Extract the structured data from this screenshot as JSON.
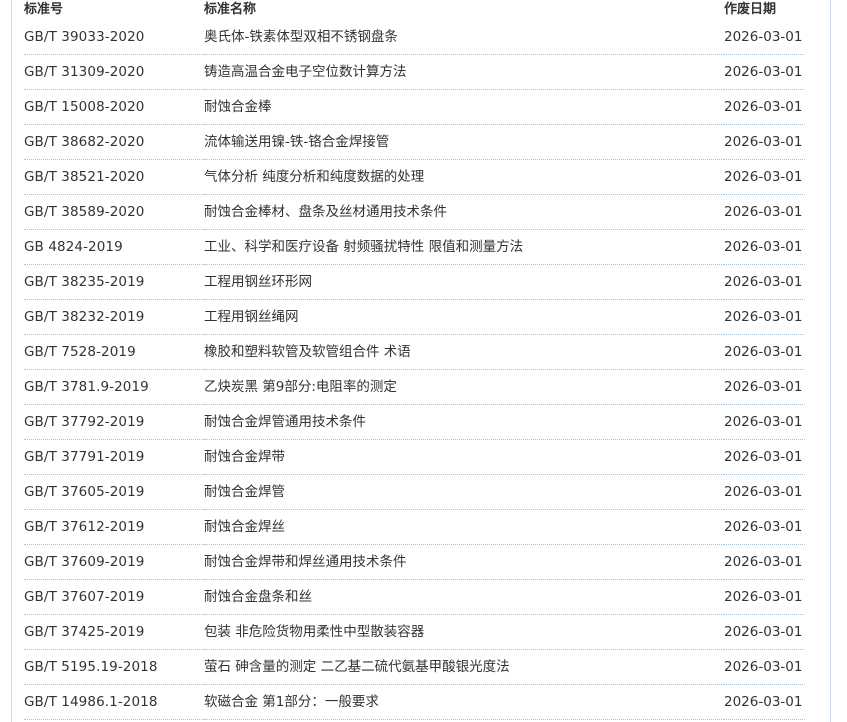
{
  "table": {
    "headers": {
      "code": "标准号",
      "name": "标准名称",
      "date": "作废日期"
    },
    "rows": [
      {
        "code": "GB/T 39033-2020",
        "name": "奥氏体-铁素体型双相不锈钢盘条",
        "date": "2026-03-01"
      },
      {
        "code": "GB/T 31309-2020",
        "name": "铸造高温合金电子空位数计算方法",
        "date": "2026-03-01"
      },
      {
        "code": "GB/T 15008-2020",
        "name": "耐蚀合金棒",
        "date": "2026-03-01"
      },
      {
        "code": "GB/T 38682-2020",
        "name": "流体输送用镍-铁-铬合金焊接管",
        "date": "2026-03-01"
      },
      {
        "code": "GB/T 38521-2020",
        "name": "气体分析 纯度分析和纯度数据的处理",
        "date": "2026-03-01"
      },
      {
        "code": "GB/T 38589-2020",
        "name": "耐蚀合金棒材、盘条及丝材通用技术条件",
        "date": "2026-03-01"
      },
      {
        "code": "GB 4824-2019",
        "name": "工业、科学和医疗设备 射频骚扰特性 限值和测量方法",
        "date": "2026-03-01"
      },
      {
        "code": "GB/T 38235-2019",
        "name": "工程用钢丝环形网",
        "date": "2026-03-01"
      },
      {
        "code": "GB/T 38232-2019",
        "name": "工程用钢丝绳网",
        "date": "2026-03-01"
      },
      {
        "code": "GB/T 7528-2019",
        "name": "橡胶和塑料软管及软管组合件 术语",
        "date": "2026-03-01"
      },
      {
        "code": "GB/T 3781.9-2019",
        "name": "乙炔炭黑 第9部分:电阻率的测定",
        "date": "2026-03-01"
      },
      {
        "code": "GB/T 37792-2019",
        "name": "耐蚀合金焊管通用技术条件",
        "date": "2026-03-01"
      },
      {
        "code": "GB/T 37791-2019",
        "name": "耐蚀合金焊带",
        "date": "2026-03-01"
      },
      {
        "code": "GB/T 37605-2019",
        "name": "耐蚀合金焊管",
        "date": "2026-03-01"
      },
      {
        "code": "GB/T 37612-2019",
        "name": "耐蚀合金焊丝",
        "date": "2026-03-01"
      },
      {
        "code": "GB/T 37609-2019",
        "name": "耐蚀合金焊带和焊丝通用技术条件",
        "date": "2026-03-01"
      },
      {
        "code": "GB/T 37607-2019",
        "name": "耐蚀合金盘条和丝",
        "date": "2026-03-01"
      },
      {
        "code": "GB/T 37425-2019",
        "name": "包装 非危险货物用柔性中型散装容器",
        "date": "2026-03-01"
      },
      {
        "code": "GB/T 5195.19-2018",
        "name": "萤石 砷含量的测定 二乙基二硫代氨基甲酸银光度法",
        "date": "2026-03-01"
      },
      {
        "code": "GB/T 14986.1-2018",
        "name": "软磁合金 第1部分：一般要求",
        "date": "2026-03-01"
      }
    ]
  }
}
